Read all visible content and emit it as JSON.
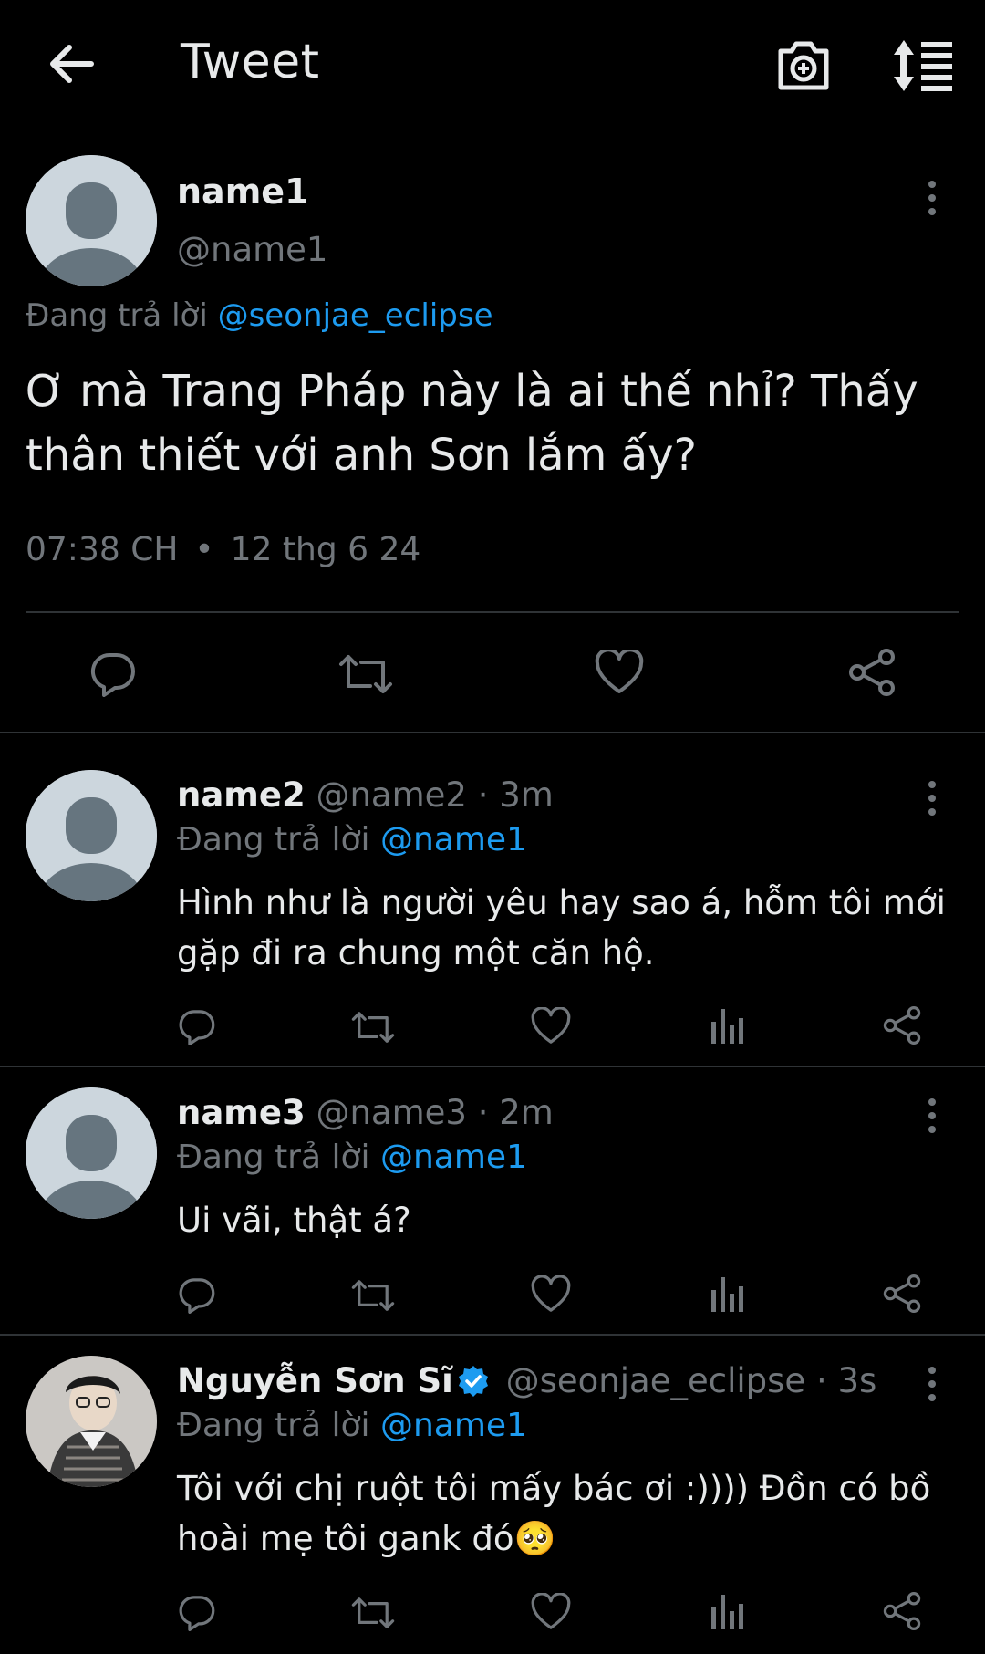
{
  "header": {
    "title": "Tweet",
    "back_icon": "arrow-left-icon",
    "camera_icon": "camera-plus-icon",
    "sort_icon": "sort-list-icon"
  },
  "main_tweet": {
    "name": "name1",
    "handle": "@name1",
    "reply_prefix": "Đang trả lời",
    "reply_to": "@seonjae_eclipse",
    "text": "Ơ mà Trang Pháp này là ai thế nhỉ? Thấy thân thiết với anh Sơn lắm ấy?",
    "time": "07:38 CH",
    "separator": "•",
    "date": "12 thg 6 24"
  },
  "replies": [
    {
      "name": "name2",
      "handle": "@name2",
      "age": "· 3m",
      "reply_prefix": "Đang trả lời",
      "reply_to": "@name1",
      "text": "Hình như là người yêu hay sao á, hỗm tôi mới gặp đi ra chung một căn hộ."
    },
    {
      "name": "name3",
      "handle": "@name3",
      "age": "· 2m",
      "reply_prefix": "Đang trả lời",
      "reply_to": "@name1",
      "text": "Ui vãi, thật á?"
    },
    {
      "name": "Nguyễn Sơn Sĩ",
      "handle": "@seonjae_eclipse",
      "age": "· 3s",
      "reply_prefix": "Đang trả lời",
      "reply_to": "@name1",
      "text": "Tôi với chị ruột tôi mấy bác ơi :)))) Đồn có bồ hoài mẹ tôi gank đó🥺",
      "verified": true
    }
  ],
  "colors": {
    "background": "#000000",
    "text": "#e7e9ea",
    "secondary": "#71767b",
    "accent": "#1d9bf0",
    "divider": "#2f3336"
  }
}
